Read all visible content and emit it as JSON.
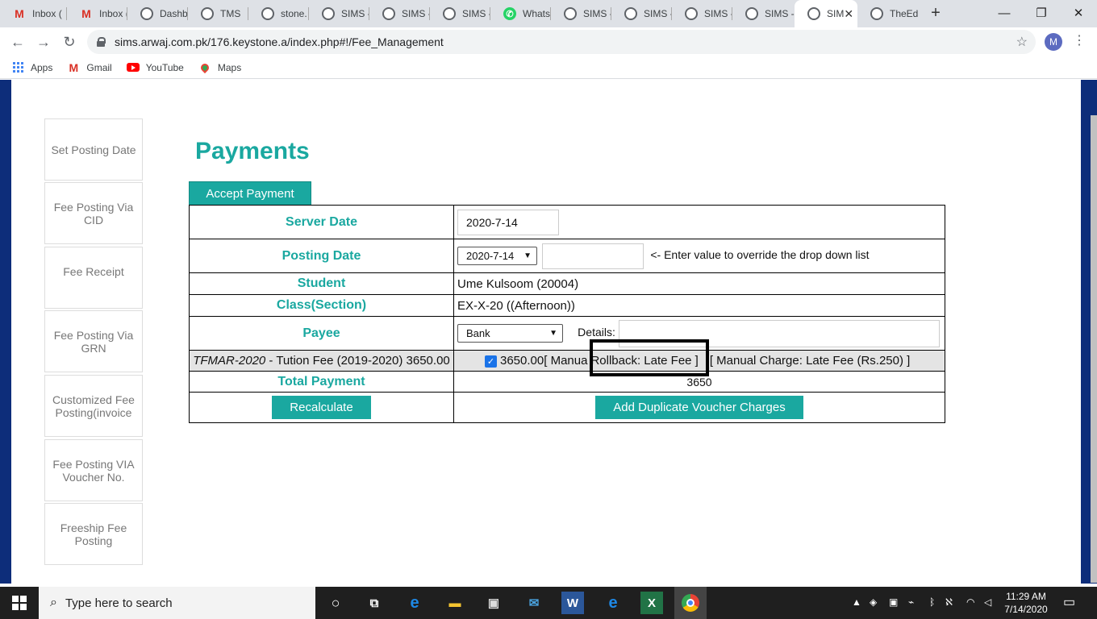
{
  "browser": {
    "tabs": [
      {
        "label": "Inbox (",
        "icon": "gmail-icon"
      },
      {
        "label": "Inbox (",
        "icon": "gmail-icon"
      },
      {
        "label": "Dashb",
        "icon": "globe-icon"
      },
      {
        "label": "TMS",
        "icon": "globe-icon"
      },
      {
        "label": "stone.",
        "icon": "globe-icon"
      },
      {
        "label": "SIMS -",
        "icon": "globe-icon"
      },
      {
        "label": "SIMS -",
        "icon": "globe-icon"
      },
      {
        "label": "SIMS -",
        "icon": "globe-icon"
      },
      {
        "label": "Whats",
        "icon": "whatsapp-icon"
      },
      {
        "label": "SIMS -",
        "icon": "globe-icon"
      },
      {
        "label": "SIMS -",
        "icon": "globe-icon"
      },
      {
        "label": "SIMS -",
        "icon": "globe-icon"
      },
      {
        "label": "SIMS -",
        "icon": "globe-icon"
      },
      {
        "label": "SIM",
        "icon": "globe-icon",
        "active": true
      },
      {
        "label": "TheEd",
        "icon": "globe-icon"
      }
    ],
    "url": "sims.arwaj.com.pk/176.keystone.a/index.php#!/Fee_Management",
    "profile_initial": "M",
    "bookmarks": [
      "Apps",
      "Gmail",
      "YouTube",
      "Maps"
    ]
  },
  "sidebar": {
    "items": [
      {
        "label": "Set Posting Date"
      },
      {
        "label": "Fee Posting Via CID"
      },
      {
        "label": "Fee Receipt"
      },
      {
        "label": "Fee Posting Via GRN"
      },
      {
        "label": "Customized Fee Posting(invoice"
      },
      {
        "label": "Fee Posting VIA Voucher No."
      },
      {
        "label": "Freeship Fee Posting"
      }
    ]
  },
  "main": {
    "title": "Payments",
    "tab_label": "Accept Payment",
    "server_date_label": "Server Date",
    "server_date_value": "2020-7-14",
    "posting_date_label": "Posting Date",
    "posting_date_select": "2020-7-14",
    "posting_date_hint": "<- Enter value to override the drop down list",
    "student_label": "Student",
    "student_value": "Ume Kulsoom (20004)",
    "class_label": "Class(Section)",
    "class_value": "EX-X-20 ((Afternoon))",
    "payee_label": "Payee",
    "payee_select": "Bank",
    "details_label": "Details:",
    "fee_code": "TFMAR-2020",
    "fee_desc": " - Tution Fee (2019-2020) 3650.00",
    "fee_amount": "3650.00",
    "fee_manual_prefix": "[ Manua",
    "fee_rollback": "Rollback: Late Fee ]",
    "fee_manual_charge": "[ Manual Charge: Late Fee (Rs.250) ]",
    "total_label": "Total Payment",
    "total_value": "3650",
    "recalculate_label": "Recalculate",
    "duplicate_label": "Add Duplicate Voucher Charges"
  },
  "taskbar": {
    "search_placeholder": "Type here to search",
    "time": "11:29 AM",
    "date": "7/14/2020"
  },
  "colors": {
    "accent": "#1aa8a0",
    "page_bg": "#1e3a8a"
  }
}
